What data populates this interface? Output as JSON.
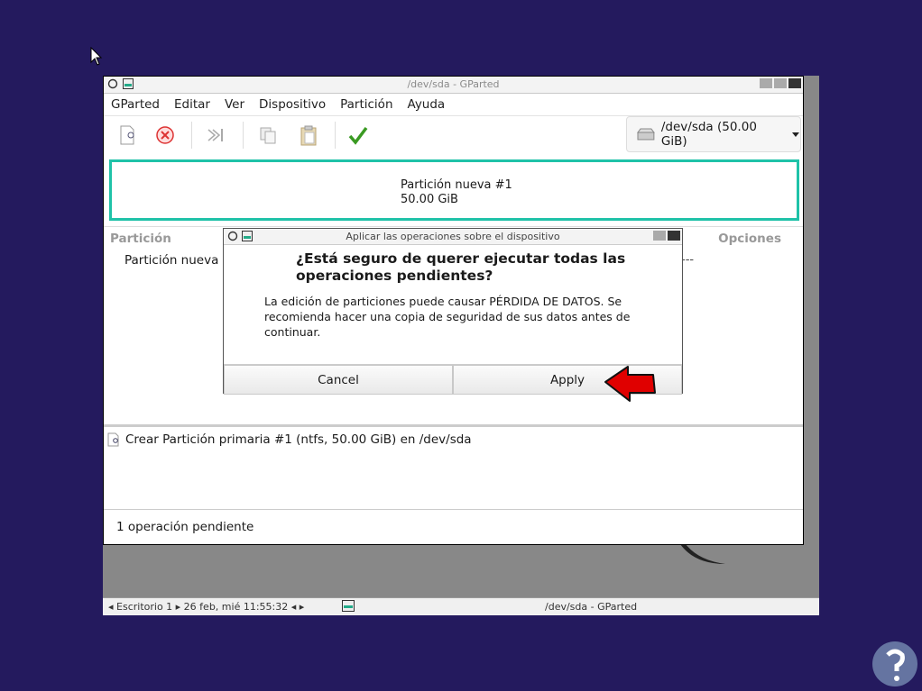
{
  "desktop": {
    "taskbar_left": "◂ Escritorio 1 ▸   26 feb, mié 11:55:32   ◂ ▸",
    "taskbar_right": "/dev/sda - GParted"
  },
  "window": {
    "title": "/dev/sda - GParted",
    "menu": [
      "GParted",
      "Editar",
      "Ver",
      "Dispositivo",
      "Partición",
      "Ayuda"
    ],
    "device_selector": "/dev/sda (50.00 GiB)",
    "partition_visual": {
      "name": "Partición nueva #1",
      "size": "50.00 GiB"
    },
    "list_header": {
      "partition": "Partición",
      "flags": "Opciones"
    },
    "list_row": {
      "name": "Partición nueva #",
      "trailing": "---"
    },
    "pending_operation": "Crear Partición primaria #1 (ntfs, 50.00 GiB) en /dev/sda",
    "status": "1 operación pendiente"
  },
  "dialog": {
    "title": "Aplicar las operaciones sobre el dispositivo",
    "heading": "¿Está seguro de querer ejecutar todas las operaciones pendientes?",
    "body": "La edición de particiones puede causar PÉRDIDA DE DATOS. Se recomienda hacer una copia de seguridad de sus datos antes de continuar.",
    "cancel_label": "Cancel",
    "apply_label": "Apply"
  },
  "colors": {
    "background": "#241a5e",
    "selection_border": "#1fc2a8",
    "arrow": "#e00000"
  },
  "icons": [
    "new-partition-icon",
    "delete-icon",
    "resize-move-icon",
    "copy-icon",
    "paste-icon",
    "apply-icon",
    "disk-icon",
    "dropdown-icon",
    "debian-icon",
    "red-arrow-icon",
    "watermark-logo"
  ]
}
